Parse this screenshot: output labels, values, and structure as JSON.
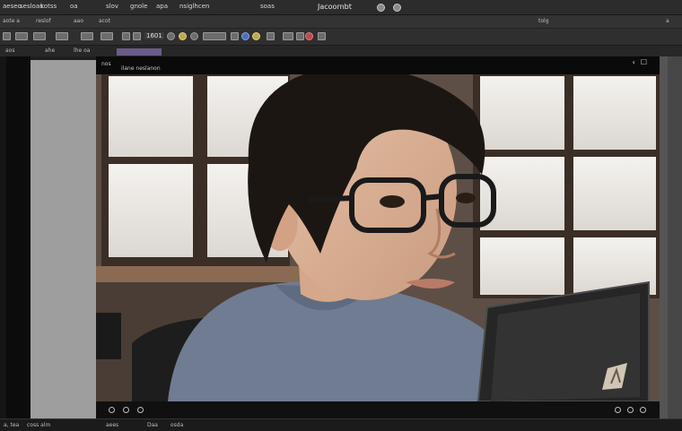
{
  "app": {
    "title": "Jacoornbt"
  },
  "menubar": {
    "items": [
      "aeseo",
      "sesloas",
      "kotss",
      "oa",
      "slov",
      "gnole",
      "apa",
      "nsiglhcen",
      "soas"
    ]
  },
  "toolbar1": {
    "items": [
      "aote a",
      "reslof",
      "aao",
      "acot",
      "tolg",
      "a"
    ]
  },
  "toolbar2": {
    "frame": "1601"
  },
  "tabs": {
    "items": [
      "aos",
      "ahe",
      "lhe oa"
    ]
  },
  "viewer": {
    "title": "nos",
    "subtitle": "ilane neslanon",
    "buttons": [
      "‹",
      "☐"
    ]
  },
  "statusbar": {
    "items": [
      "a, tea",
      "coss alm",
      "aees",
      "Daa",
      "osda"
    ]
  },
  "colors": {
    "app_bg": "#1f1f1f",
    "panel_gray": "#9e9e9e",
    "tab_active": "#6b5b8a"
  }
}
